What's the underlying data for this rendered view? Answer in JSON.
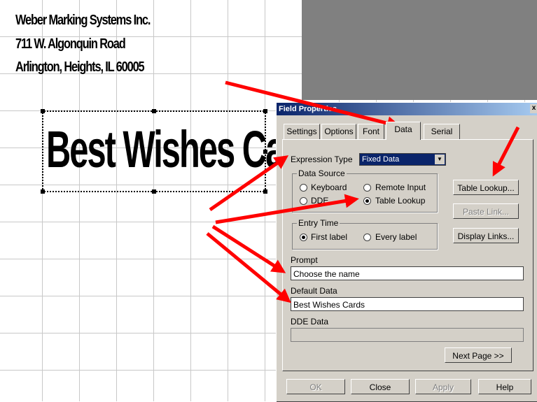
{
  "canvas": {
    "address_line1": "Weber Marking Systems Inc.",
    "address_line2": "711 W. Algonquin Road",
    "address_line3": "Arlington, Heights, IL 60005",
    "field_text": "Best Wishes Cards"
  },
  "dialog": {
    "title": "Field Properties",
    "close_glyph": "x",
    "tabs": [
      "Settings",
      "Options",
      "Font",
      "Data",
      "Serial"
    ],
    "active_tab": "Data",
    "expression_type_label": "Expression Type",
    "expression_type_value": "Fixed Data",
    "data_source": {
      "legend": "Data Source",
      "options": [
        "Keyboard",
        "Remote Input",
        "DDE",
        "Table Lookup"
      ],
      "selected": "Table Lookup"
    },
    "entry_time": {
      "legend": "Entry Time",
      "options": [
        "First label",
        "Every label"
      ],
      "selected": "First label"
    },
    "buttons": {
      "table_lookup": "Table Lookup...",
      "paste_link": "Paste Link...",
      "display_links": "Display Links...",
      "next_page": "Next Page >>",
      "ok": "OK",
      "close": "Close",
      "apply": "Apply",
      "help": "Help"
    },
    "prompt_label": "Prompt",
    "prompt_value": "Choose the name",
    "default_data_label": "Default Data",
    "default_data_value": "Best Wishes Cards",
    "dde_data_label": "DDE Data",
    "dde_data_value": ""
  },
  "colors": {
    "annotation_arrow": "#ff0000",
    "dialog_face": "#d4d0c8",
    "title_bar": "#0a246a",
    "gray_area": "#808080"
  }
}
